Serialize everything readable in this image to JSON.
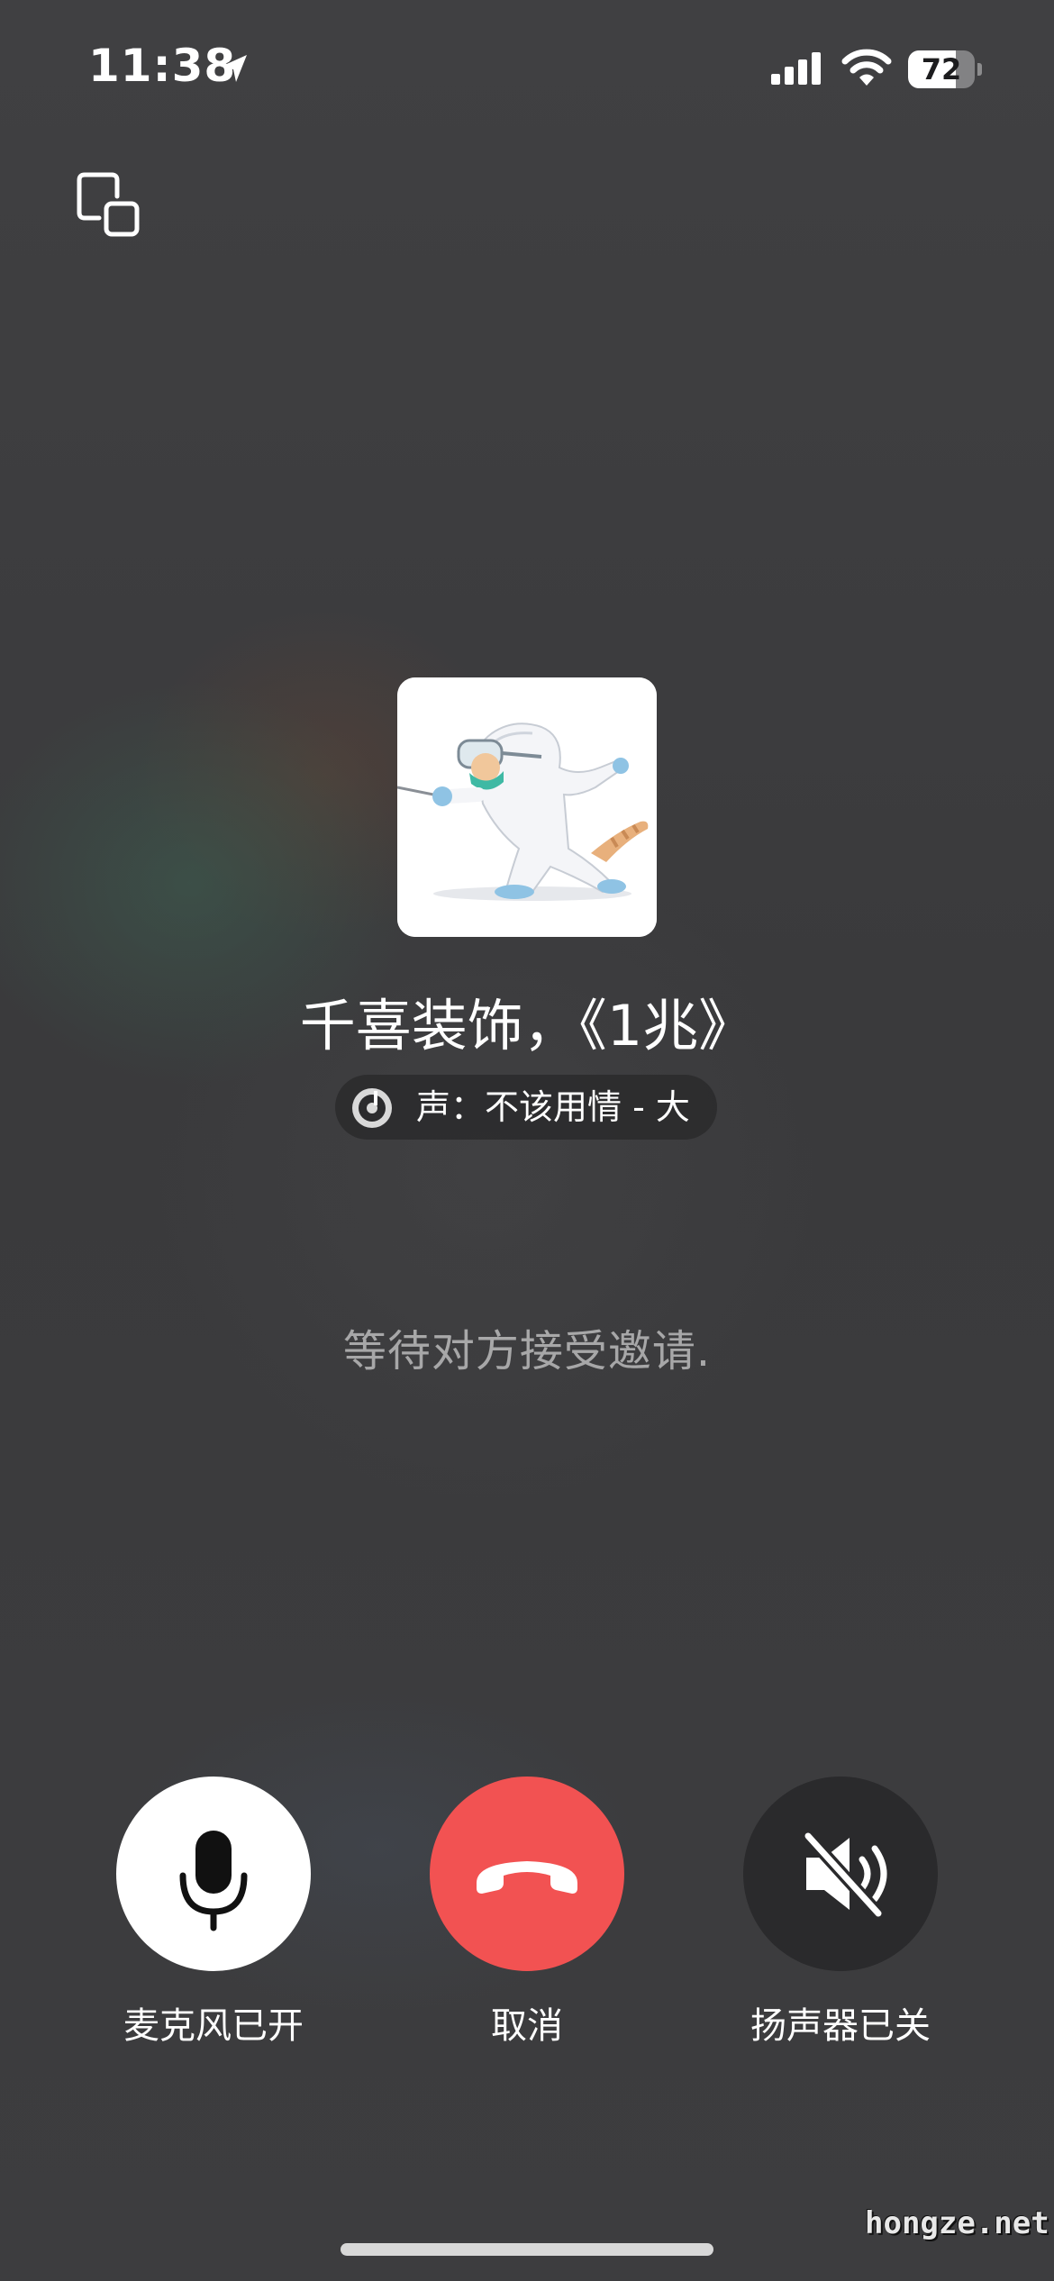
{
  "status_bar": {
    "time": "11:38",
    "battery_percent": "72",
    "battery_level": 0.72,
    "location_icon": "location-arrow-icon",
    "signal_icon": "cellular-signal-icon",
    "wifi_icon": "wifi-icon"
  },
  "header": {
    "float_icon": "floating-window-icon"
  },
  "caller": {
    "name": "千喜装饰，《1兆》",
    "ringtone_icon": "music-disc-icon",
    "ringtone_text": "声：不该用情 - 大",
    "status": "等待对方接受邀请."
  },
  "controls": {
    "microphone": {
      "label": "麦克风已开",
      "icon": "microphone-icon",
      "state": "on"
    },
    "cancel": {
      "label": "取消",
      "icon": "hang-up-icon",
      "color": "#f25252"
    },
    "speaker": {
      "label": "扬声器已关",
      "icon": "speaker-muted-icon",
      "state": "off"
    }
  },
  "watermark": "hongze.net",
  "colors": {
    "cancel_red": "#f25252",
    "mic_on_bg": "#ffffff",
    "speaker_off_bg": "#2a2a2c"
  }
}
